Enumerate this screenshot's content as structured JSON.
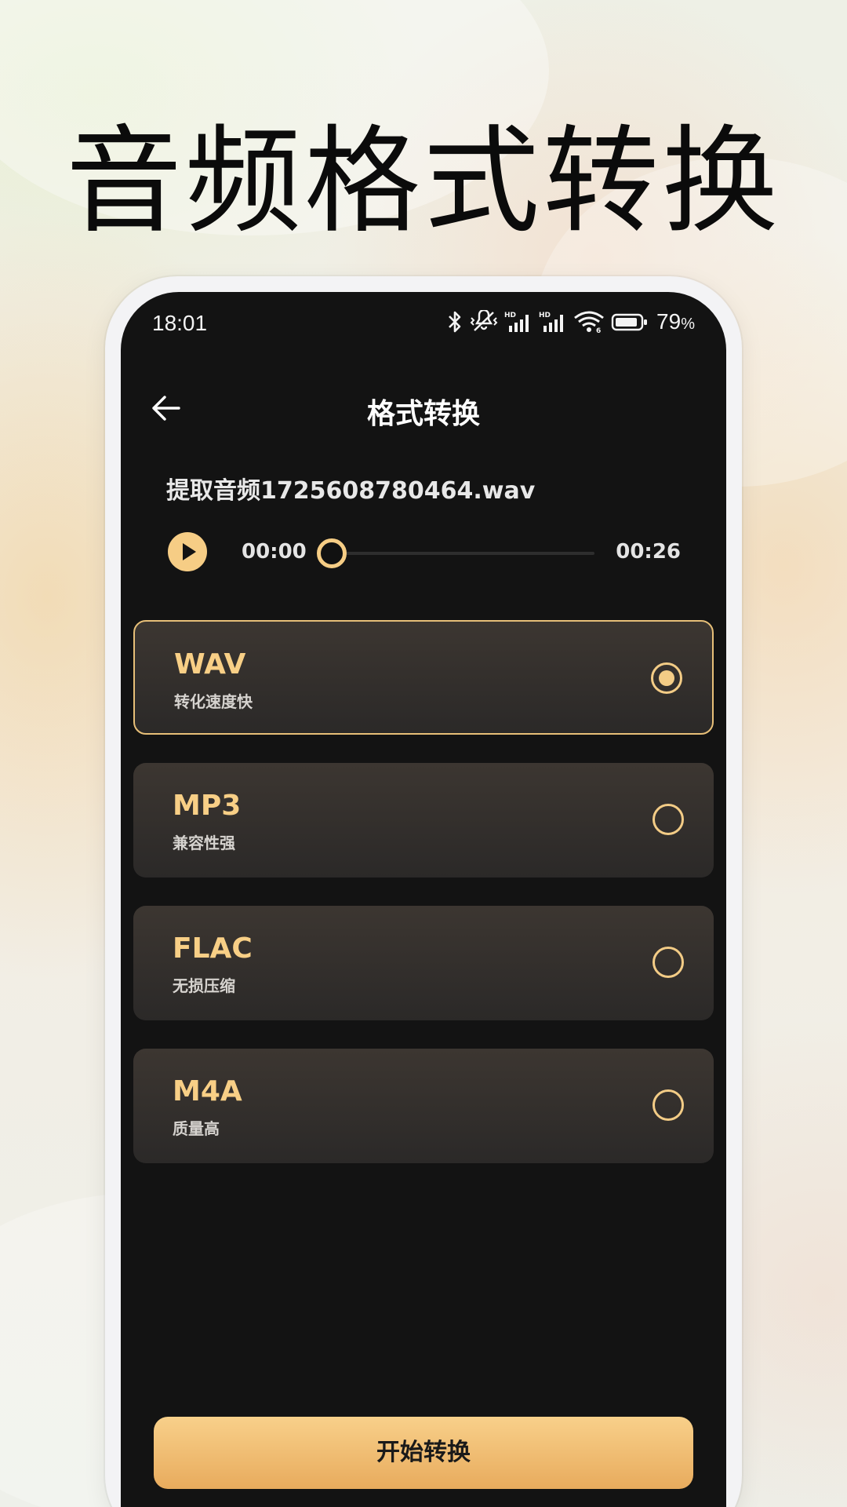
{
  "headline": "音频格式转换",
  "status_bar": {
    "time": "18:01",
    "battery_percent": "79",
    "battery_symbol": "%",
    "icons": [
      "bluetooth-icon",
      "mute-vibrate-icon",
      "hd-signal-icon",
      "hd-signal-icon",
      "wifi-icon",
      "battery-icon"
    ]
  },
  "nav": {
    "title": "格式转换",
    "back_icon": "arrow-left-icon"
  },
  "file": {
    "name": "提取音频1725608780464.wav"
  },
  "player": {
    "current_time": "00:00",
    "total_time": "00:26",
    "progress": 0,
    "play_icon": "play-icon"
  },
  "formats": [
    {
      "name": "WAV",
      "desc": "转化速度快",
      "selected": true
    },
    {
      "name": "MP3",
      "desc": "兼容性强",
      "selected": false
    },
    {
      "name": "FLAC",
      "desc": "无损压缩",
      "selected": false
    },
    {
      "name": "M4A",
      "desc": "质量高",
      "selected": false
    }
  ],
  "actions": {
    "start_label": "开始转换"
  },
  "colors": {
    "accent": "#f6cd85",
    "screen_bg": "#131313",
    "card_top": "#3c3631",
    "card_bottom": "#2b2928",
    "button_top": "#f8d08a",
    "button_bottom": "#e8ab5d"
  }
}
